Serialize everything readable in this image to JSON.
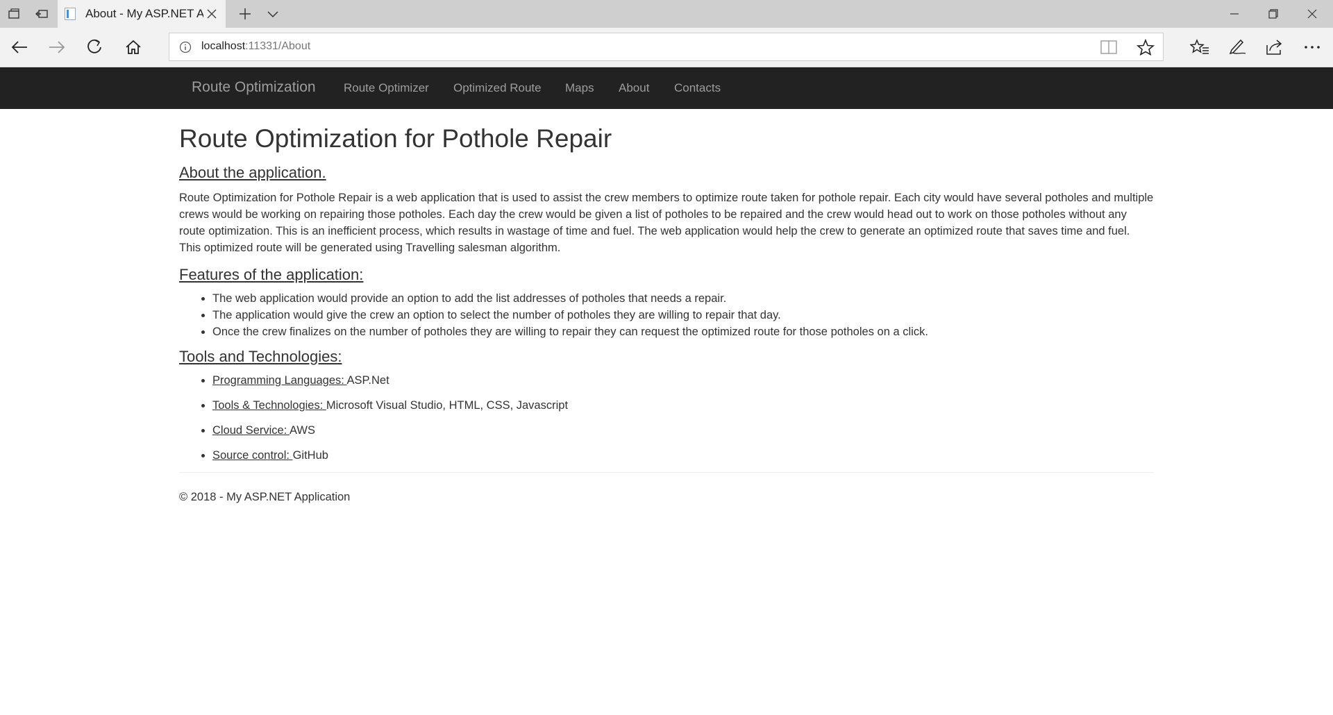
{
  "browser": {
    "tab_title": "About - My ASP.NET Application",
    "url_host": "localhost",
    "url_rest": ":11331/About"
  },
  "nav": {
    "brand": "Route Optimization",
    "links": [
      "Route Optimizer",
      "Optimized Route",
      "Maps",
      "About",
      "Contacts"
    ]
  },
  "page": {
    "title": "Route Optimization for Pothole Repair",
    "about_heading": "About the application.",
    "about_text": "Route Optimization for Pothole Repair is a web application that is used to assist the crew members to optimize route taken for pothole repair. Each city would have several potholes and multiple crews would be working on repairing those potholes. Each day the crew would be given a list of potholes to be repaired and the crew would head out to work on those potholes without any route optimization. This is an inefficient process, which results in wastage of time and fuel. The web application would help the crew to generate an optimized route that saves time and fuel. This optimized route will be generated using Travelling salesman algorithm.",
    "features_heading": "Features of the application:",
    "features": [
      "The web application would provide an option to add the list addresses of potholes that needs a repair.",
      "The application would give the crew an option to select the number of potholes they are willing to repair that day.",
      "Once the crew finalizes on the number of potholes they are willing to repair they can request the optimized route for those potholes on a click."
    ],
    "tools_heading": "Tools and Technologies:",
    "tools": [
      {
        "label": "Programming Languages: ",
        "value": "ASP.Net"
      },
      {
        "label": "Tools & Technologies: ",
        "value": "Microsoft Visual Studio, HTML, CSS, Javascript"
      },
      {
        "label": "Cloud Service: ",
        "value": "AWS"
      },
      {
        "label": "Source control: ",
        "value": "GitHub"
      }
    ],
    "footer": "© 2018 - My ASP.NET Application"
  }
}
